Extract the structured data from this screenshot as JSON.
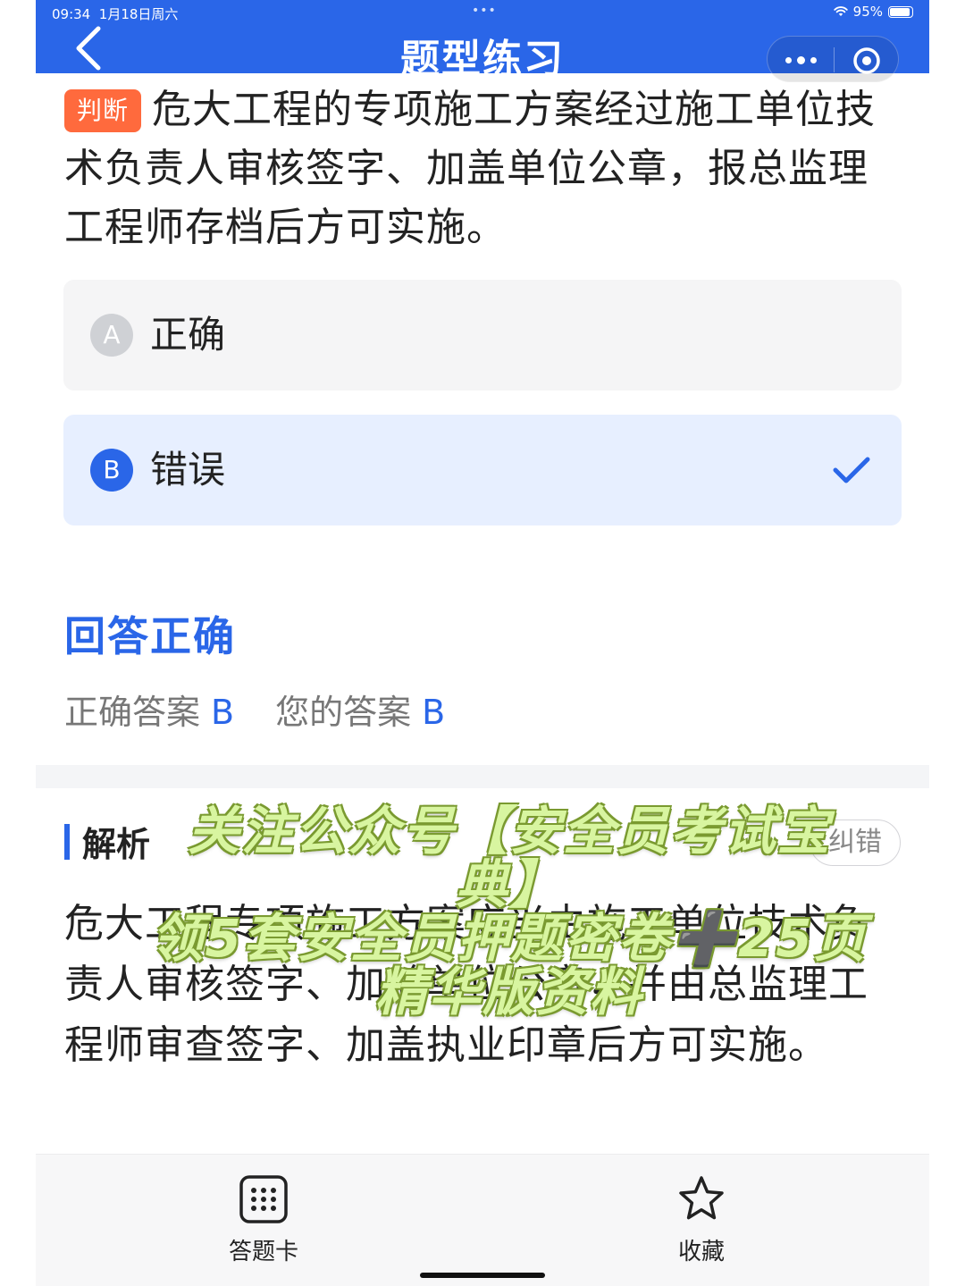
{
  "status_bar": {
    "time": "09:34",
    "date": "1月18日周六",
    "battery": "95%"
  },
  "header": {
    "title": "题型练习"
  },
  "question": {
    "type_label": "判断",
    "text": "危大工程的专项施工方案经过施工单位技术负责人审核签字、加盖单位公章，报总监理工程师存档后方可实施。"
  },
  "options": [
    {
      "letter": "A",
      "text": "正确",
      "selected": false
    },
    {
      "letter": "B",
      "text": "错误",
      "selected": true
    }
  ],
  "result": {
    "title": "回答正确",
    "correct_label": "正确答案",
    "correct_value": "B",
    "yours_label": "您的答案",
    "yours_value": "B"
  },
  "analysis": {
    "label": "解析",
    "report_button": "纠错",
    "text": "危大工程专项施工方案应当由施工单位技术负责人审核签字、加盖单位公章，并由总监理工程师审查签字、加盖执业印章后方可实施。"
  },
  "watermark": {
    "line1": "关注公众号【安全员考试宝",
    "line2": "典】",
    "line3": "领5套安全员押题密卷➕25页",
    "line4": "精华版资料"
  },
  "bottom_bar": {
    "answer_card_label": "答题卡",
    "favorite_label": "收藏"
  },
  "colors": {
    "primary": "#2a66e8",
    "type_badge": "#ff6a3d",
    "watermark": "#d8f5a0"
  },
  "icons": {
    "back": "chevron-left-icon",
    "more": "more-dots-icon",
    "close": "target-circle-icon",
    "check": "checkmark-icon",
    "answer_card": "grid-card-icon",
    "favorite": "star-outline-icon"
  }
}
